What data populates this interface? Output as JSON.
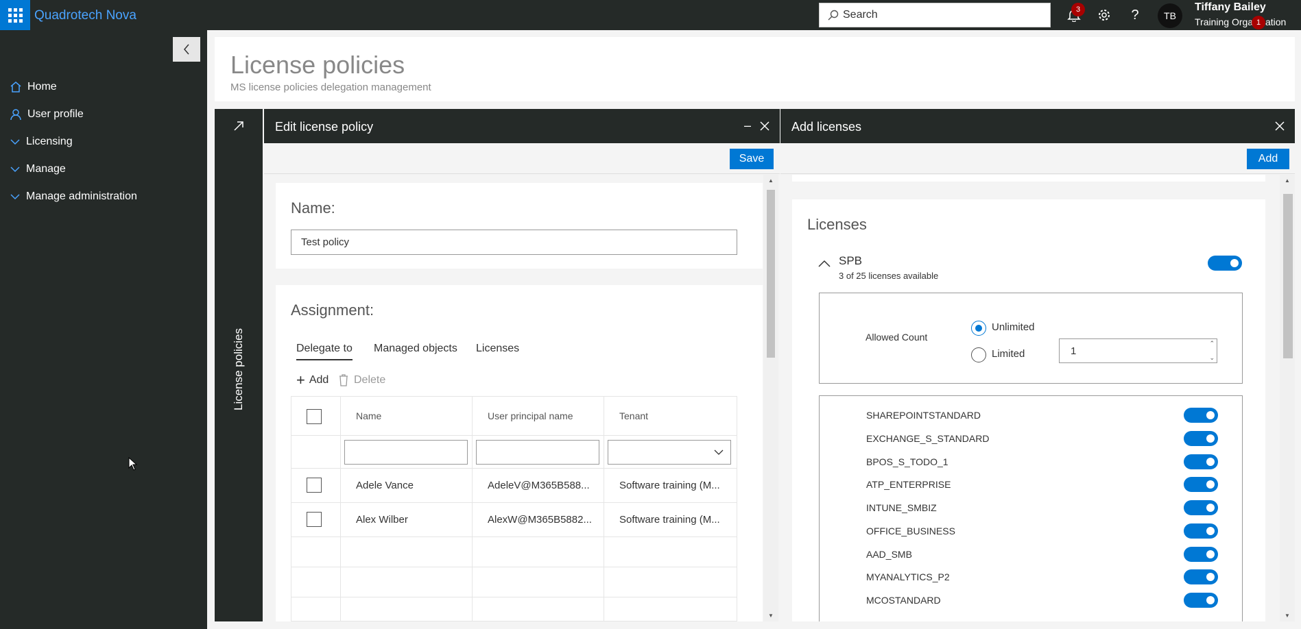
{
  "app": {
    "name": "Quadrotech Nova"
  },
  "topbar": {
    "search_placeholder": "Search",
    "notification_count": "3",
    "user_initials": "TB",
    "user_name": "Tiffany Bailey",
    "user_org": "Training Organization",
    "org_badge": "1"
  },
  "sidebar": {
    "items": [
      {
        "label": "Home",
        "icon": "home-icon"
      },
      {
        "label": "User profile",
        "icon": "person-icon"
      },
      {
        "label": "Licensing",
        "icon": "chevron-down-icon"
      },
      {
        "label": "Manage",
        "icon": "chevron-down-icon"
      },
      {
        "label": "Manage administration",
        "icon": "chevron-down-icon"
      }
    ]
  },
  "page": {
    "title": "License policies",
    "subtitle": "MS license policies delegation management",
    "side_label": "License policies"
  },
  "edit_panel": {
    "title": "Edit license policy",
    "save_label": "Save",
    "name_label": "Name:",
    "name_value": "Test policy",
    "assignment_label": "Assignment:",
    "tabs": [
      "Delegate to",
      "Managed objects",
      "Licenses"
    ],
    "add_label": "Add",
    "delete_label": "Delete",
    "columns": [
      "Name",
      "User principal name",
      "Tenant"
    ],
    "rows": [
      {
        "name": "Adele Vance",
        "upn": "AdeleV@M365B588...",
        "tenant": "Software training (M..."
      },
      {
        "name": "Alex Wilber",
        "upn": "AlexW@M365B5882...",
        "tenant": "Software training (M..."
      }
    ]
  },
  "add_panel": {
    "title": "Add licenses",
    "add_label": "Add",
    "section_title": "Licenses",
    "sku": {
      "name": "SPB",
      "availability": "3 of 25 licenses available",
      "enabled": true
    },
    "allowed_count_label": "Allowed Count",
    "unlimited_label": "Unlimited",
    "limited_label": "Limited",
    "limited_value": "1",
    "selected_option": "Unlimited",
    "services": [
      {
        "name": "SHAREPOINTSTANDARD",
        "enabled": true
      },
      {
        "name": "EXCHANGE_S_STANDARD",
        "enabled": true
      },
      {
        "name": "BPOS_S_TODO_1",
        "enabled": true
      },
      {
        "name": "ATP_ENTERPRISE",
        "enabled": true
      },
      {
        "name": "INTUNE_SMBIZ",
        "enabled": true
      },
      {
        "name": "OFFICE_BUSINESS",
        "enabled": true
      },
      {
        "name": "AAD_SMB",
        "enabled": true
      },
      {
        "name": "MYANALYTICS_P2",
        "enabled": true
      },
      {
        "name": "MCOSTANDARD",
        "enabled": true
      }
    ]
  },
  "colors": {
    "accent": "#0078d4",
    "chrome": "#252a28",
    "link": "#4aa3ff",
    "badge": "#a80000"
  }
}
